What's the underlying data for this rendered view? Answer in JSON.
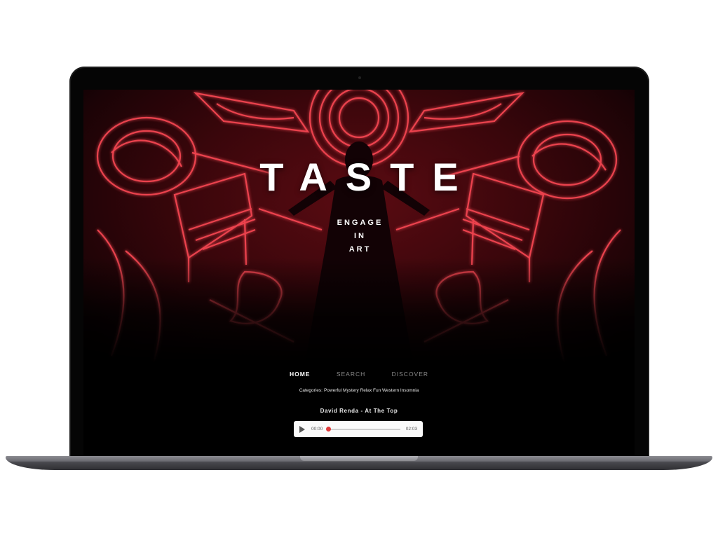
{
  "brand": {
    "title": "TASTE",
    "tagline": [
      "ENGAGE",
      "IN",
      "ART"
    ]
  },
  "nav": {
    "items": [
      {
        "label": "HOME",
        "active": true
      },
      {
        "label": "SEARCH",
        "active": false
      },
      {
        "label": "DISCOVER",
        "active": false
      }
    ]
  },
  "categories": {
    "label": "Categories:",
    "tags": "Powerful Mystery Relax Fun Western Insomnia"
  },
  "player": {
    "track": "David Renda - At The Top",
    "current_time": "00:00",
    "duration": "02:03",
    "progress": 0.0,
    "accent": "#e03a3a"
  },
  "colors": {
    "neon": "#ff4a55",
    "background": "#000000"
  }
}
